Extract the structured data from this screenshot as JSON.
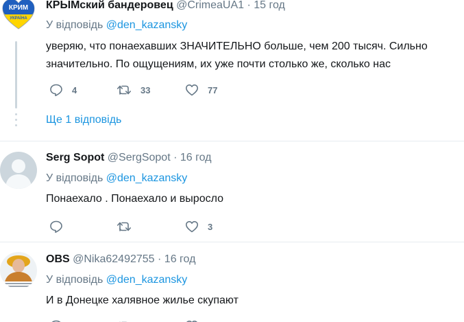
{
  "reply_prefix": "У відповідь",
  "tweets": [
    {
      "name": "КРЫМский бандеровец",
      "handle": "@CrimeaUA1",
      "separator": "·",
      "time": "15 год",
      "reply_to": "@den_kazansky",
      "avatar_logo_text": [
        "КРИМ",
        "УКРАЇНА"
      ],
      "text_lines": [
        "уверяю, что понаехавших ЗНАЧИТЕЛЬНО больше, чем 200 тысяч. Сильно",
        "значительно. По ощущениям, их уже почти столько же, сколько нас"
      ],
      "replies": "4",
      "retweets": "33",
      "likes": "77",
      "more_replies": "Ще 1 відповідь"
    },
    {
      "name": "Serg Sopot",
      "handle": "@SergSopot",
      "separator": "·",
      "time": "16 год",
      "reply_to": "@den_kazansky",
      "text_lines": [
        "Понаехало  . Понаехало и выросло"
      ],
      "replies": "",
      "retweets": "",
      "likes": "3"
    },
    {
      "name": "OBS",
      "handle": "@Nika62492755",
      "separator": "·",
      "time": "16 год",
      "reply_to": "@den_kazansky",
      "text_lines": [
        "И в Донецке халявное жилье скупают"
      ]
    }
  ],
  "colors": {
    "link": "#1b95e0",
    "secondary_text": "#657786",
    "primary_text": "#14171a",
    "divider": "#e6ecf0",
    "thread_line": "#ccd6dd"
  }
}
